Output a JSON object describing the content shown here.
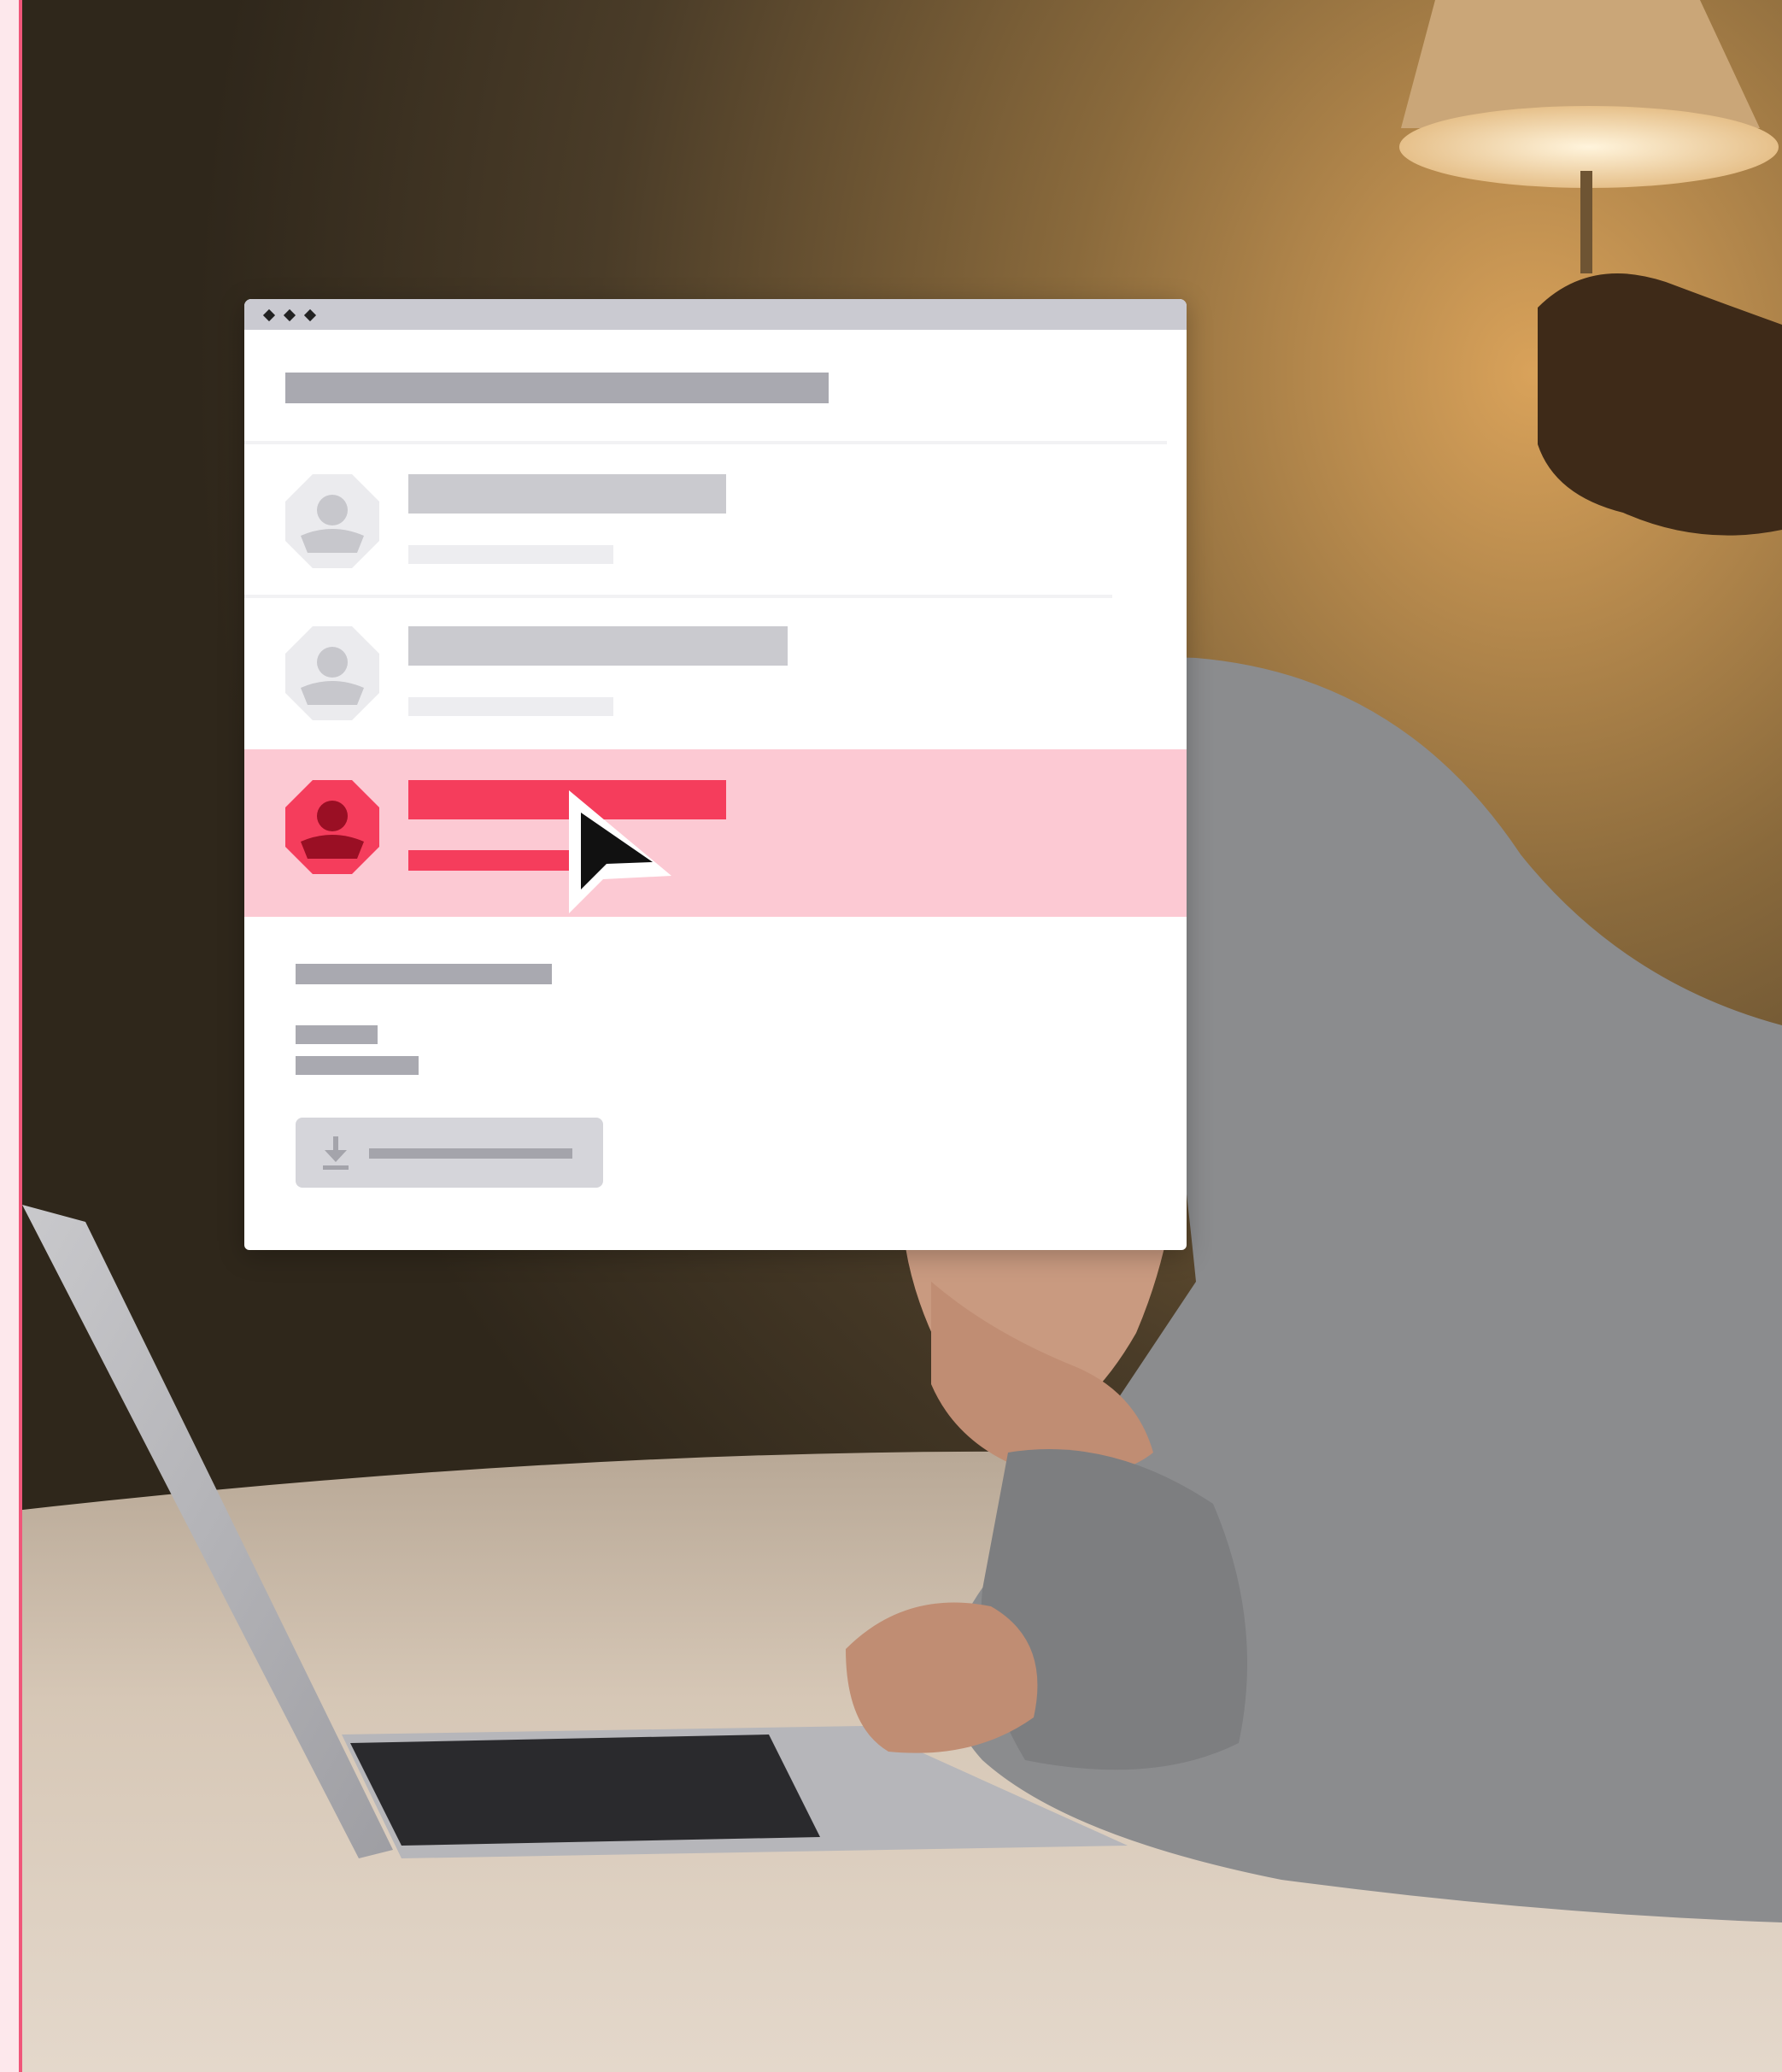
{
  "colors": {
    "accent": "#f53d5c",
    "accent_dark": "#9a0f24",
    "selection_background": "#fcc9d3",
    "placeholder_bar": "#cacacf",
    "placeholder_bar_dark": "#a9a9b0",
    "titlebar": "#cacad1"
  },
  "window": {
    "controls": [
      "window-dot-icon",
      "window-dot-icon",
      "window-dot-icon"
    ],
    "list": [
      {
        "avatar_icon": "user-avatar-icon",
        "state": "default"
      },
      {
        "avatar_icon": "user-avatar-icon",
        "state": "default"
      },
      {
        "avatar_icon": "user-avatar-icon",
        "state": "selected"
      }
    ],
    "download_button": {
      "icon": "download-icon"
    }
  },
  "cursor": {
    "icon": "mouse-pointer-icon"
  }
}
